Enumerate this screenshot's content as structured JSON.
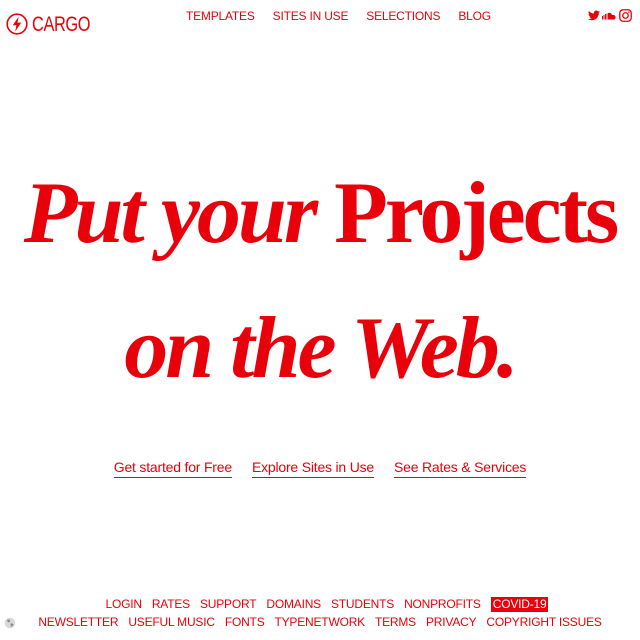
{
  "brand": {
    "name": "CARGO",
    "icon": "lightning-bolt-icon",
    "color": "#e8000b"
  },
  "top_nav": [
    {
      "label": "TEMPLATES"
    },
    {
      "label": "SITES IN USE"
    },
    {
      "label": "SELECTIONS"
    },
    {
      "label": "BLOG"
    }
  ],
  "social_icons": [
    "twitter-icon",
    "soundcloud-icon",
    "instagram-icon"
  ],
  "hero": {
    "line1_italic": "Put your ",
    "line1_roman": "Projects",
    "line2_italic": "on the Web."
  },
  "cta_links": [
    {
      "label": "Get started for Free"
    },
    {
      "label": "Explore Sites in Use"
    },
    {
      "label": "See Rates & Services"
    }
  ],
  "footer": {
    "row1": [
      {
        "label": "LOGIN"
      },
      {
        "label": "RATES"
      },
      {
        "label": "SUPPORT"
      },
      {
        "label": "DOMAINS"
      },
      {
        "label": "STUDENTS"
      },
      {
        "label": "NONPROFITS"
      },
      {
        "label": "COVID-19",
        "highlighted": true
      }
    ],
    "row2": [
      {
        "label": "NEWSLETTER"
      },
      {
        "label": "USEFUL MUSIC"
      },
      {
        "label": "FONTS"
      },
      {
        "label": "TYPENETWORK"
      },
      {
        "label": "TERMS"
      },
      {
        "label": "PRIVACY"
      },
      {
        "label": "COPYRIGHT ISSUES"
      }
    ]
  },
  "bottom_icon": "globe-icon",
  "colors": {
    "accent": "#e8000b",
    "background": "#ffffff",
    "highlight_text": "#ffffff"
  }
}
